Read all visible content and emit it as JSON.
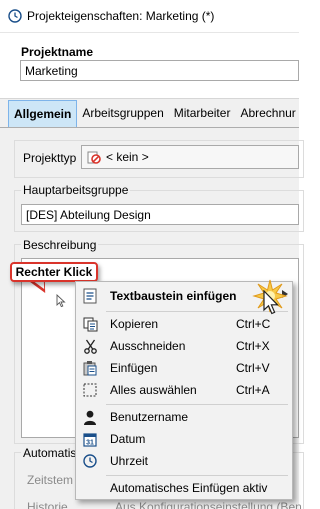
{
  "window": {
    "title": "Projekteigenschaften: Marketing (*)"
  },
  "projektname": {
    "label": "Projektname",
    "value": "Marketing"
  },
  "tabs": [
    {
      "label": "Allgemein",
      "active": true
    },
    {
      "label": "Arbeitsgruppen"
    },
    {
      "label": "Mitarbeiter"
    },
    {
      "label": "Abrechnur"
    }
  ],
  "projekttyp": {
    "label": "Projekttyp",
    "value": "< kein >"
  },
  "hauptarbeitsgruppe": {
    "label": "Hauptarbeitsgruppe",
    "value": "[DES] Abteilung Design"
  },
  "beschreibung": {
    "label": "Beschreibung"
  },
  "callout": {
    "text": "Rechter Klick"
  },
  "bottom": {
    "automatisch_label": "Automatis",
    "zeitstempel_label": "Zeitstem",
    "historie_label": "Historie",
    "historie_value": "Aus Konfigurationseinstellung (Ben"
  },
  "context_menu": {
    "items": [
      {
        "label": "Textbaustein einfügen",
        "icon": "text-block-icon",
        "bold": true
      },
      {
        "label": "Kopieren",
        "shortcut": "Ctrl+C",
        "icon": "copy-icon"
      },
      {
        "label": "Ausschneiden",
        "shortcut": "Ctrl+X",
        "icon": "scissors-icon"
      },
      {
        "label": "Einfügen",
        "shortcut": "Ctrl+V",
        "icon": "paste-icon"
      },
      {
        "label": "Alles auswählen",
        "shortcut": "Ctrl+A",
        "icon": "select-all-icon"
      },
      {
        "label": "Benutzername",
        "icon": "user-icon"
      },
      {
        "label": "Datum",
        "icon": "calendar-icon",
        "icon_text": "31"
      },
      {
        "label": "Uhrzeit",
        "icon": "clock-icon"
      },
      {
        "label": "Automatisches Einfügen aktiv"
      }
    ]
  },
  "colors": {
    "callout_border": "#d9342b",
    "tab_active_bg": "#cde6f7",
    "panel_bg": "#f0f0f0"
  }
}
